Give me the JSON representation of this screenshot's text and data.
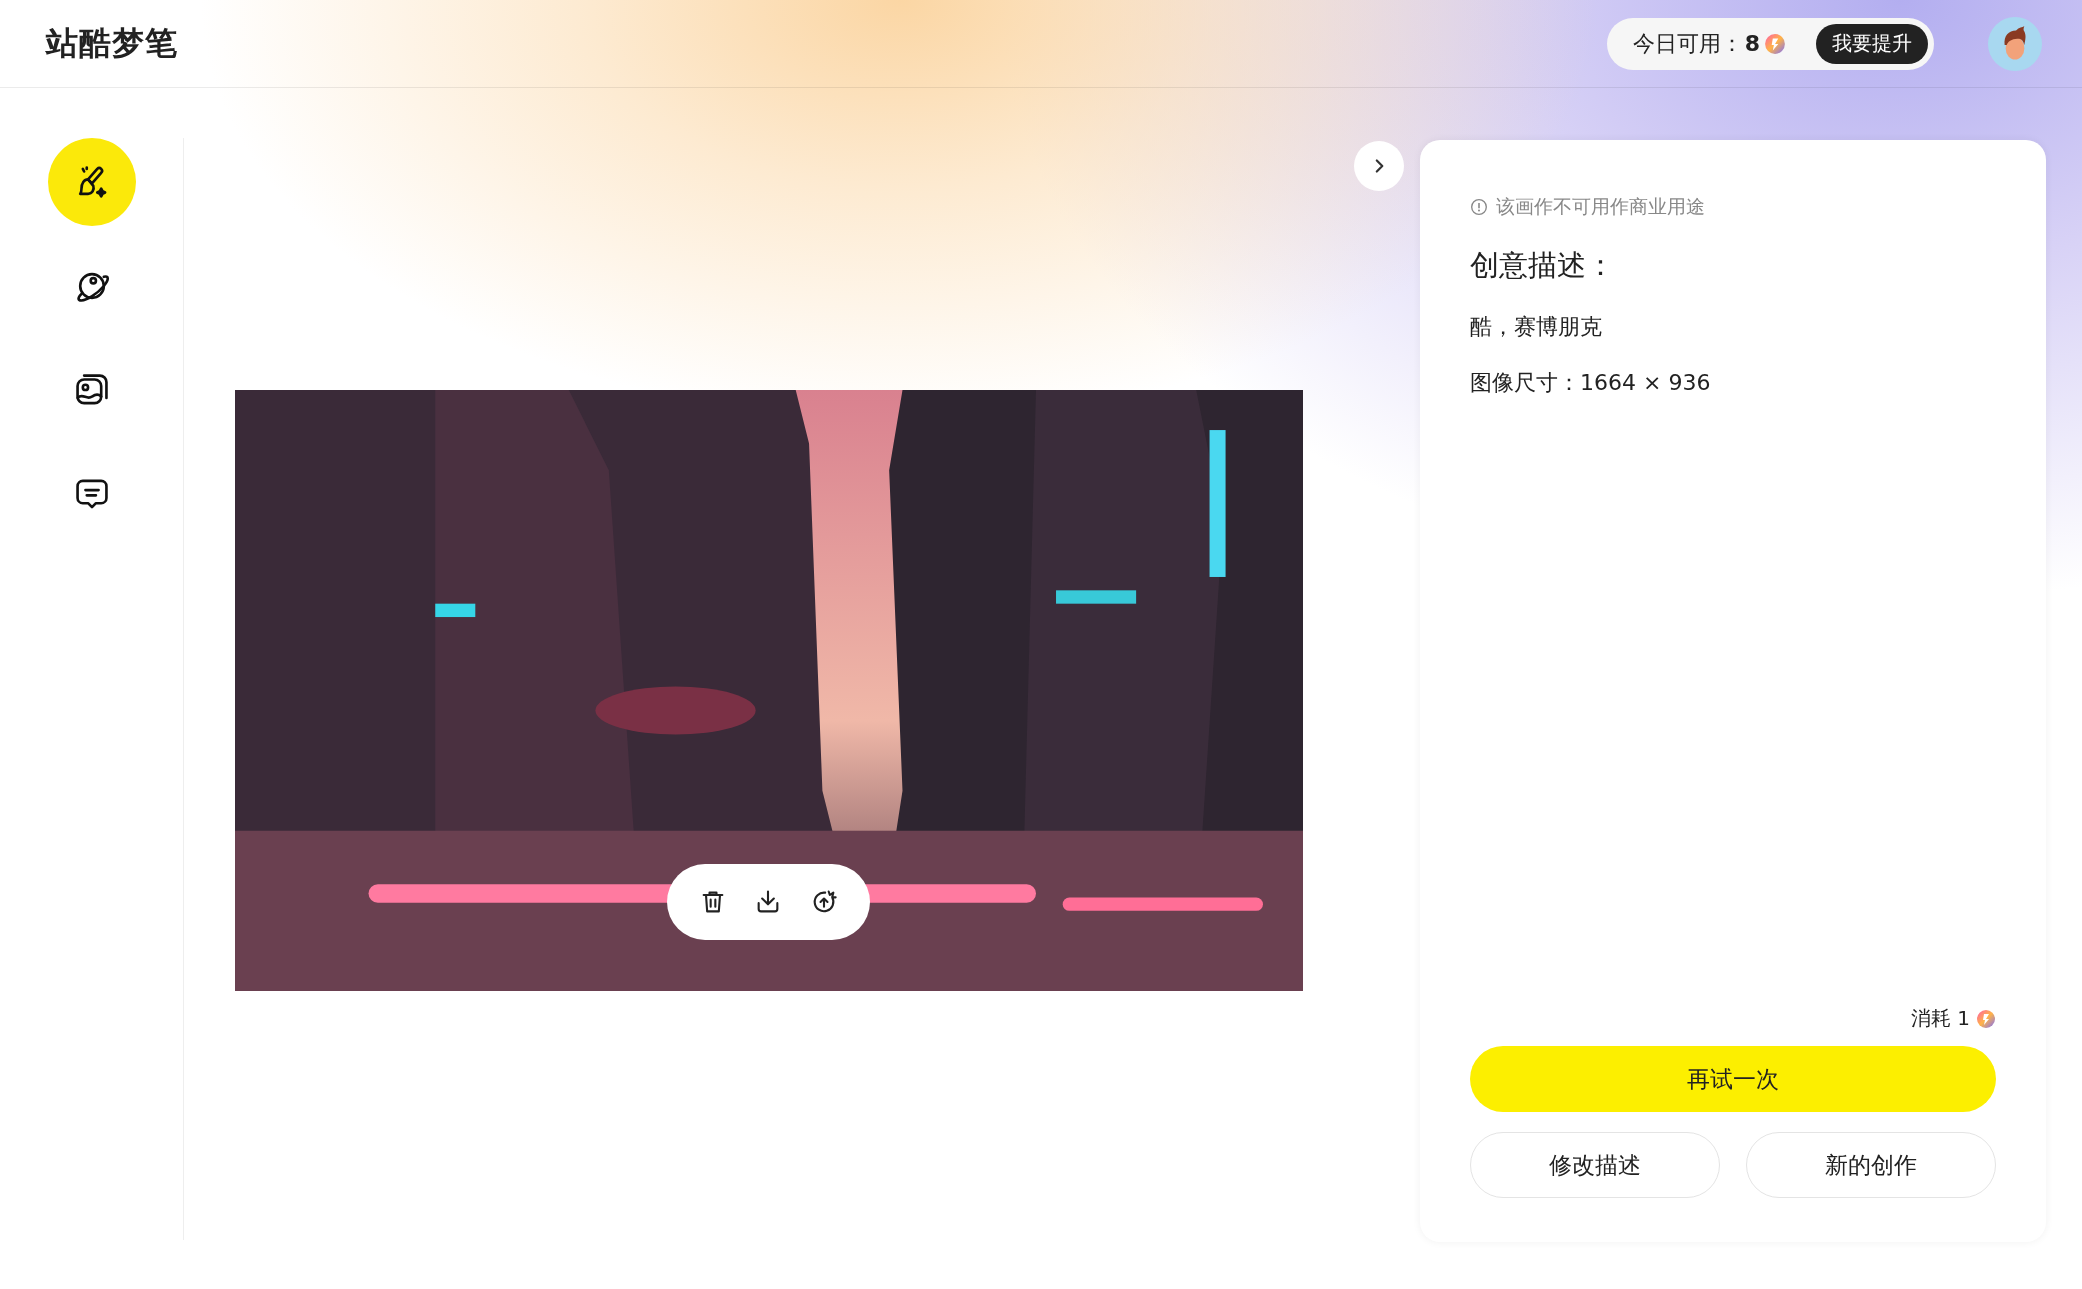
{
  "header": {
    "logo": "站酷梦笔",
    "quota_label": "今日可用：",
    "quota_count": "8",
    "upgrade_button": "我要提升"
  },
  "sidebar": {
    "items": [
      {
        "kind": "create",
        "selected": true
      },
      {
        "kind": "explore",
        "selected": false
      },
      {
        "kind": "gallery",
        "selected": false
      },
      {
        "kind": "chat",
        "selected": false
      }
    ]
  },
  "details": {
    "notice": "该画作不可用作商业用途",
    "title": "创意描述：",
    "description": "酷，赛博朋克",
    "size": "图像尺寸：1664 × 936",
    "cost": "消耗 1",
    "buttons": [
      {
        "kind": "primary",
        "label": "再试一次"
      },
      {
        "kind": "secondary",
        "label": "修改描述"
      },
      {
        "kind": "secondary",
        "label": "新的创作"
      }
    ]
  }
}
